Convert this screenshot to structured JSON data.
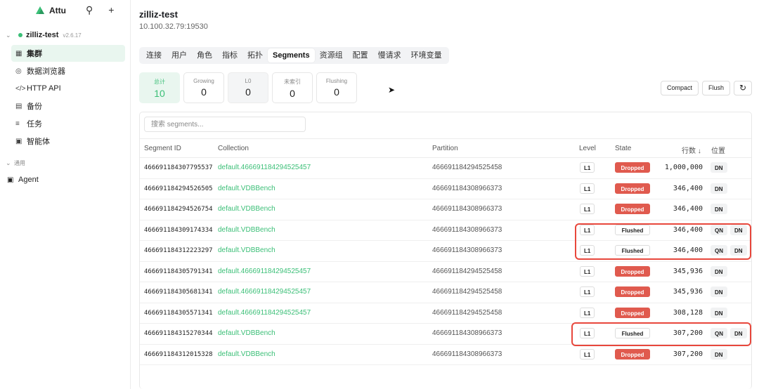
{
  "sidebar": {
    "brand": "Attu",
    "connection": {
      "name": "zilliz-test",
      "version": "v2.6.17"
    },
    "items": [
      {
        "label": "集群",
        "icon": "grid-icon"
      },
      {
        "label": "数据浏览器",
        "icon": "compass-icon"
      },
      {
        "label": "HTTP API",
        "icon": "code-icon"
      },
      {
        "label": "备份",
        "icon": "database-icon"
      },
      {
        "label": "任务",
        "icon": "list-icon"
      },
      {
        "label": "智能体",
        "icon": "robot-icon"
      }
    ],
    "group_label": "通用",
    "agent_label": "Agent"
  },
  "header": {
    "title": "zilliz-test",
    "address": "10.100.32.79:19530"
  },
  "tabs": [
    "连接",
    "用户",
    "角色",
    "指标",
    "拓扑",
    "Segments",
    "资源组",
    "配置",
    "慢请求",
    "环境变量"
  ],
  "active_tab": "Segments",
  "stats": [
    {
      "label": "总计",
      "value": "10"
    },
    {
      "label": "Growing",
      "value": "0"
    },
    {
      "label": "L0",
      "value": "0"
    },
    {
      "label": "未索引",
      "value": "0"
    },
    {
      "label": "Flushing",
      "value": "0"
    }
  ],
  "actions": {
    "compact": "Compact",
    "flush": "Flush"
  },
  "search": {
    "placeholder": "搜索 segments..."
  },
  "table": {
    "headers": {
      "id": "Segment ID",
      "collection": "Collection",
      "partition": "Partition",
      "level": "Level",
      "state": "State",
      "rows": "行数 ↓",
      "position": "位置"
    },
    "rows": [
      {
        "id": "466691184307795537",
        "collection": "default.466691184294525457",
        "partition": "466691184294525458",
        "level": "L1",
        "state": "Dropped",
        "rows": "1,000,000",
        "pos": [
          "DN"
        ]
      },
      {
        "id": "466691184294526505",
        "collection": "default.VDBBench",
        "partition": "466691184308966373",
        "level": "L1",
        "state": "Dropped",
        "rows": "346,400",
        "pos": [
          "DN"
        ]
      },
      {
        "id": "466691184294526754",
        "collection": "default.VDBBench",
        "partition": "466691184308966373",
        "level": "L1",
        "state": "Dropped",
        "rows": "346,400",
        "pos": [
          "DN"
        ]
      },
      {
        "id": "466691184309174334",
        "collection": "default.VDBBench",
        "partition": "466691184308966373",
        "level": "L1",
        "state": "Flushed",
        "rows": "346,400",
        "pos": [
          "QN",
          "DN"
        ]
      },
      {
        "id": "466691184312223297",
        "collection": "default.VDBBench",
        "partition": "466691184308966373",
        "level": "L1",
        "state": "Flushed",
        "rows": "346,400",
        "pos": [
          "QN",
          "DN"
        ]
      },
      {
        "id": "466691184305791341",
        "collection": "default.466691184294525457",
        "partition": "466691184294525458",
        "level": "L1",
        "state": "Dropped",
        "rows": "345,936",
        "pos": [
          "DN"
        ]
      },
      {
        "id": "466691184305681341",
        "collection": "default.466691184294525457",
        "partition": "466691184294525458",
        "level": "L1",
        "state": "Dropped",
        "rows": "345,936",
        "pos": [
          "DN"
        ]
      },
      {
        "id": "466691184305571341",
        "collection": "default.466691184294525457",
        "partition": "466691184294525458",
        "level": "L1",
        "state": "Dropped",
        "rows": "308,128",
        "pos": [
          "DN"
        ]
      },
      {
        "id": "466691184315270344",
        "collection": "default.VDBBench",
        "partition": "466691184308966373",
        "level": "L1",
        "state": "Flushed",
        "rows": "307,200",
        "pos": [
          "QN",
          "DN"
        ]
      },
      {
        "id": "466691184312015328",
        "collection": "default.VDBBench",
        "partition": "466691184308966373",
        "level": "L1",
        "state": "Dropped",
        "rows": "307,200",
        "pos": [
          "DN"
        ]
      }
    ]
  },
  "colors": {
    "accent": "#3bbf77",
    "dropped": "#e05a4e",
    "highlight": "#e8473c"
  }
}
